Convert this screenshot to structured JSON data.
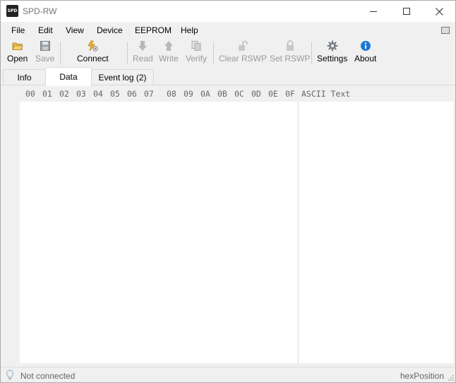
{
  "window": {
    "title": "SPD-RW",
    "icon_text": "SPD"
  },
  "menu": {
    "items": [
      "File",
      "Edit",
      "View",
      "Device",
      "EEPROM",
      "Help"
    ]
  },
  "toolbar": {
    "open": "Open",
    "save": "Save",
    "connect": "Connect",
    "read": "Read",
    "write": "Write",
    "verify": "Verify",
    "clear_rswp": "Clear RSWP",
    "set_rswp": "Set RSWP",
    "settings": "Settings",
    "about": "About"
  },
  "tabs": {
    "info": "Info",
    "data": "Data",
    "event_log": "Event log (2)"
  },
  "hex": {
    "columns": [
      "00",
      "01",
      "02",
      "03",
      "04",
      "05",
      "06",
      "07",
      "08",
      "09",
      "0A",
      "0B",
      "0C",
      "0D",
      "0E",
      "0F"
    ],
    "ascii_label": "ASCII Text"
  },
  "status": {
    "connection": "Not connected",
    "position": "hexPosition"
  },
  "colors": {
    "accent_blue": "#1e78d7",
    "disabled_gray": "#999999",
    "background": "#f0f0f0"
  }
}
